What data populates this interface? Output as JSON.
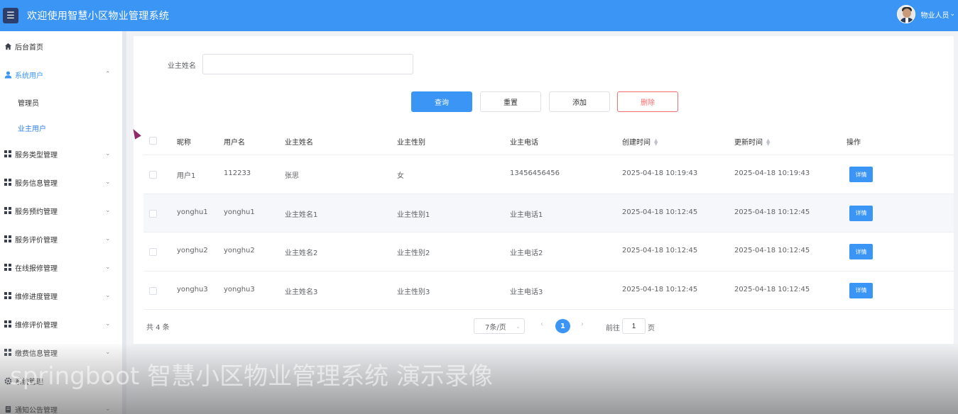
{
  "header": {
    "menu_icon": "hamburger-icon",
    "title": "欢迎使用智慧小区物业管理系统",
    "user_role": "物业人员"
  },
  "sidebar": {
    "items": [
      {
        "icon": "home-icon",
        "label": "后台首页"
      },
      {
        "icon": "user-icon",
        "label": "系统用户",
        "expanded": true,
        "children": [
          {
            "label": "管理员"
          },
          {
            "label": "业主用户",
            "active": true
          }
        ]
      },
      {
        "icon": "grid-icon",
        "label": "服务类型管理"
      },
      {
        "icon": "grid-icon",
        "label": "服务信息管理"
      },
      {
        "icon": "grid-icon",
        "label": "服务预约管理"
      },
      {
        "icon": "grid-icon",
        "label": "服务评价管理"
      },
      {
        "icon": "grid-icon",
        "label": "在线报修管理"
      },
      {
        "icon": "grid-icon",
        "label": "维修进度管理"
      },
      {
        "icon": "grid-icon",
        "label": "维修评价管理"
      },
      {
        "icon": "grid-icon",
        "label": "缴费信息管理"
      },
      {
        "icon": "gear-icon",
        "label": "系统管理"
      },
      {
        "icon": "notice-icon",
        "label": "通知公告管理"
      }
    ]
  },
  "search": {
    "label": "业主姓名",
    "value": "",
    "placeholder": ""
  },
  "buttons": {
    "query": "查询",
    "reset": "重置",
    "add": "添加",
    "delete": "删除"
  },
  "table": {
    "columns": [
      "昵称",
      "用户名",
      "业主姓名",
      "业主性别",
      "业主电话",
      "创建时间",
      "更新时间",
      "操作"
    ],
    "rows": [
      {
        "nickname": "用户1",
        "username": "112233",
        "name": "张思",
        "gender": "女",
        "phone": "13456456456",
        "created": "2025-04-18 10:19:43",
        "updated": "2025-04-18 10:19:43",
        "action": "详情"
      },
      {
        "nickname": "yonghu1",
        "username": "yonghu1",
        "name": "业主姓名1",
        "gender": "业主性别1",
        "phone": "业主电话1",
        "created": "2025-04-18 10:12:45",
        "updated": "2025-04-18 10:12:45",
        "action": "详情"
      },
      {
        "nickname": "yonghu2",
        "username": "yonghu2",
        "name": "业主姓名2",
        "gender": "业主性别2",
        "phone": "业主电话2",
        "created": "2025-04-18 10:12:45",
        "updated": "2025-04-18 10:12:45",
        "action": "详情"
      },
      {
        "nickname": "yonghu3",
        "username": "yonghu3",
        "name": "业主姓名3",
        "gender": "业主性别3",
        "phone": "业主电话3",
        "created": "2025-04-18 10:12:45",
        "updated": "2025-04-18 10:12:45",
        "action": "详情"
      }
    ]
  },
  "pagination": {
    "total_text": "共 4 条",
    "page_size": "7条/页",
    "current_page": "1",
    "goto_label": "前往",
    "goto_value": "1",
    "goto_unit": "页"
  },
  "watermark": "springboot 智慧小区物业管理系统 演示录像",
  "colors": {
    "primary": "#3b95f5",
    "danger": "#f56c6c",
    "header_bg": "#3b95f5"
  }
}
